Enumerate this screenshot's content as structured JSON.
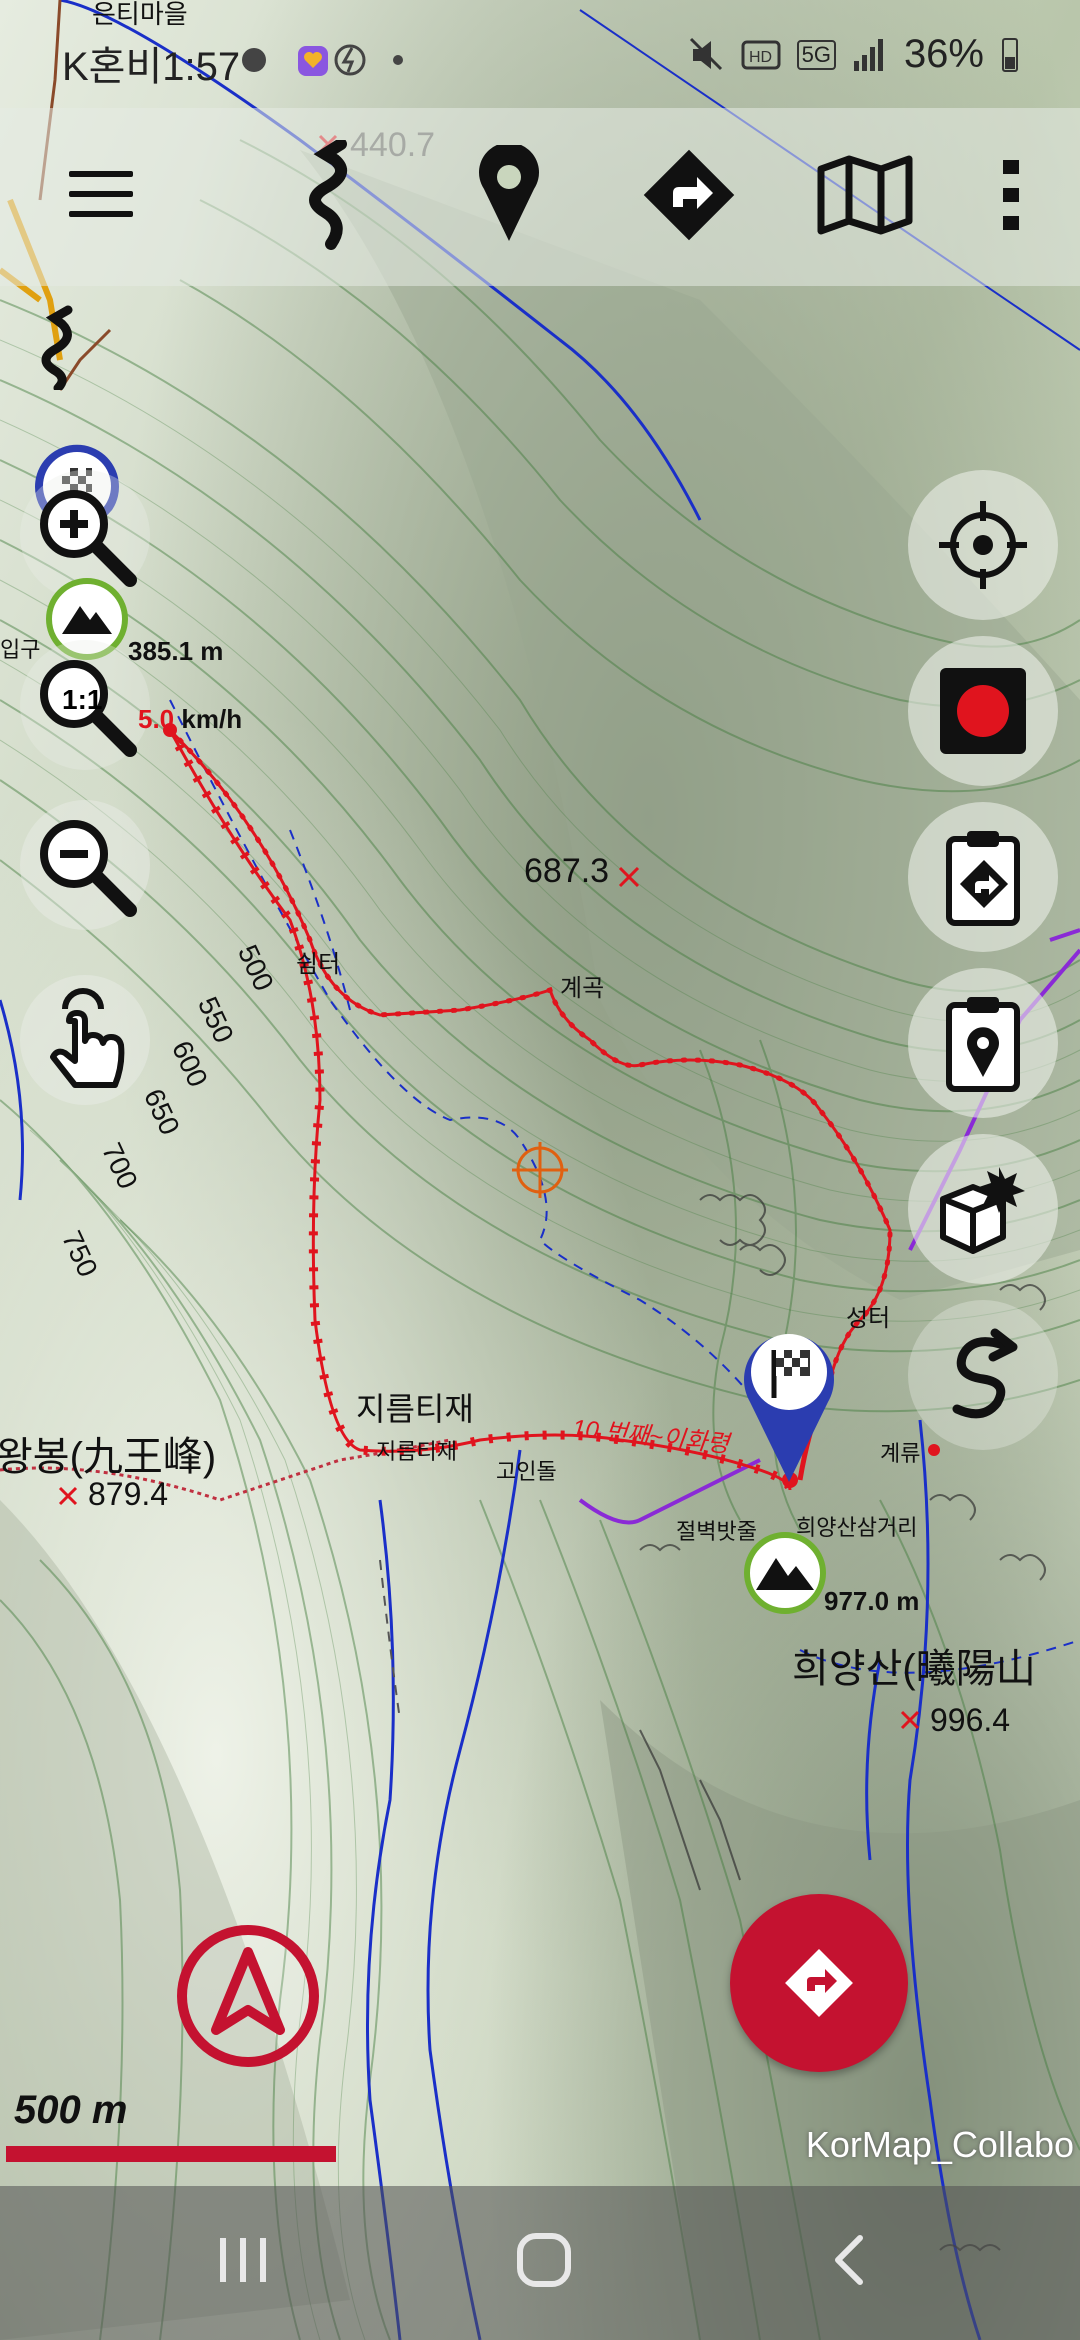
{
  "status_bar": {
    "time": "K혼비1:57",
    "battery": "36%",
    "network": "5G"
  },
  "toolbar": {
    "menu_icon": "hamburger-icon",
    "track_icon": "track-route-icon",
    "waypoint_icon": "pin-icon",
    "navigate_icon": "direction-sign-icon",
    "map_icon": "folded-map-icon",
    "more_icon": "more-vertical-icon",
    "overlay_elevation": "440.7"
  },
  "left_controls": {
    "zoom_in_icon": "zoom-in-icon",
    "zoom_1to1_label": "1:1",
    "zoom_out_icon": "zoom-out-icon",
    "touch_icon": "touch-hand-icon",
    "altitude_readout": "385.1 m",
    "speed_value": "5.0",
    "speed_unit": "km/h",
    "place_label": "입구"
  },
  "right_controls": {
    "locate_icon": "crosshair-icon",
    "record_icon": "record-icon",
    "route_clipboard_icon": "route-clipboard-icon",
    "waypoint_clipboard_icon": "waypoint-clipboard-icon",
    "poi_icon": "box-burst-icon",
    "track_tool_icon": "s-track-icon"
  },
  "map_labels": {
    "peak_687": "687.3",
    "gyegok": "계곡",
    "shimter": "쉼터",
    "contour_500": "500",
    "contour_550": "550",
    "contour_600": "600",
    "contour_650": "650",
    "contour_700": "700",
    "contour_750": "750",
    "jireumtijae_big": "지름티재",
    "jireumtijae_small": "지름티재",
    "goindol": "고인돌",
    "route_name": "10 번째~이화령",
    "seongteo": "성터",
    "gyeryu": "계류",
    "jeolbyeok": "절벽밧줄",
    "heeyang_junction": "희양산삼거리",
    "summit_altitude": "977.0 m",
    "heeyangsan": "희양산(曦陽山",
    "heeyang_height": "996.4",
    "gu_wangbong": "왕봉(九王峰)",
    "gu_height": "879.4",
    "top_village": "은티마을"
  },
  "scale": {
    "label": "500 m"
  },
  "credit": "KorMap_Collabo",
  "colors": {
    "accent_red": "#c41230",
    "track_red": "#e0141e",
    "contour_green": "#3f7a3a",
    "stream_blue": "#1a2fc8",
    "trail_purple": "#8a2ad6"
  },
  "nav_bar": {
    "recent_icon": "recent-apps-icon",
    "home_icon": "home-icon",
    "back_icon": "back-icon"
  }
}
